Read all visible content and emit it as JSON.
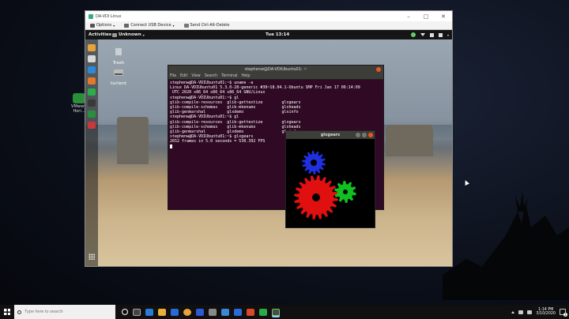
{
  "vm_window": {
    "title": "DA-VDI Linux",
    "toolbar": {
      "options": "Options",
      "usb": "Connect USB Device",
      "cad": "Send Ctrl-Alt-Delete"
    }
  },
  "guest": {
    "topbar": {
      "activities": "Activities",
      "app_menu": "Unknown",
      "clock": "Tue 13:14"
    },
    "desktop_icons": [
      {
        "label": "Trash"
      },
      {
        "label": "tsclient"
      }
    ]
  },
  "terminal": {
    "title": "stephenw@DA-VDIUbuntu01: ~",
    "menu": [
      "File",
      "Edit",
      "View",
      "Search",
      "Terminal",
      "Help"
    ],
    "lines": [
      "stephenw@DA-VDIUbuntu01:~$ uname -a",
      "Linux DA-VDIUbuntu01 5.3.0-28-generic #30~18.04.1-Ubuntu SMP Fri Jan 17 06:14:09",
      " UTC 2020 x86_64 x86_64 x86_64 GNU/Linux",
      "stephenw@DA-VDIUbuntu01:~$ gl",
      "glib-compile-resources  glib-gettextize        glxgears",
      "glib-compile-schemas    glib-mkenums           glxheads",
      "glib-genmarshal         glxdemo                glxinfo",
      "stephenw@DA-VDIUbuntu01:~$ gl",
      "glib-compile-resources  glib-gettextize        glxgears",
      "glib-compile-schemas    glib-mkenums           glxheads",
      "glib-genmarshal         glxdemo                glxinfo",
      "stephenw@DA-VDIUbuntu01:~$ glxgears",
      "2652 frames in 5.0 seconds = 530.392 FPS"
    ]
  },
  "glxgears": {
    "title": "glxgears",
    "colors": {
      "red": "#e01010",
      "green": "#10c020",
      "blue": "#2030e0"
    }
  },
  "host": {
    "desktop_icon_label": "VMware Hori...",
    "taskbar": {
      "search_placeholder": "Type here to search",
      "time": "1:14 PM",
      "date": "3/10/2020",
      "notification_count": "1"
    }
  },
  "colors": {
    "terminal_bg": "#300a24",
    "ubuntu_orange": "#e95420"
  }
}
